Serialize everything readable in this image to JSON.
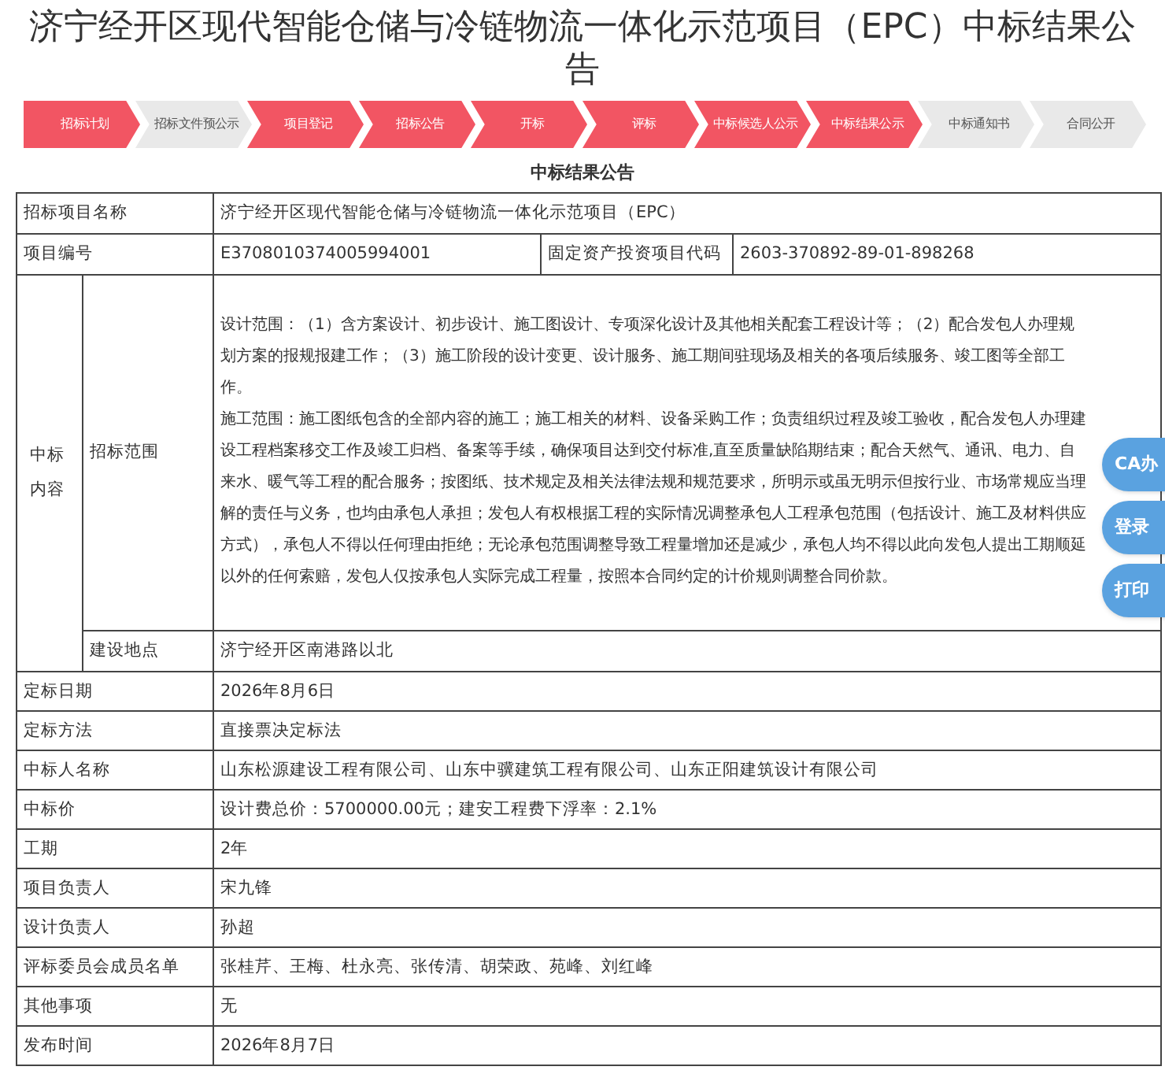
{
  "title": "济宁经开区现代智能仓储与冷链物流一体化示范项目（EPC）中标结果公告",
  "steps": [
    {
      "label": "招标计划",
      "done": true
    },
    {
      "label": "招标文件预公示",
      "done": false
    },
    {
      "label": "项目登记",
      "done": true
    },
    {
      "label": "招标公告",
      "done": true
    },
    {
      "label": "开标",
      "done": true
    },
    {
      "label": "评标",
      "done": true
    },
    {
      "label": "中标候选人公示",
      "done": true
    },
    {
      "label": "中标结果公示",
      "done": true
    },
    {
      "label": "中标通知书",
      "done": false
    },
    {
      "label": "合同公开",
      "done": false
    }
  ],
  "table": {
    "caption": "中标结果公告",
    "project_name": {
      "label": "招标项目名称",
      "value": "济宁经开区现代智能仓储与冷链物流一体化示范项目（EPC）"
    },
    "project_code": {
      "label": "项目编号",
      "value": "E3708010374005994001",
      "label_2": "固定资产投资项目代码",
      "value_2": "2603-370892-89-01-898268"
    },
    "content": {
      "label": "中标内容",
      "scope_label": "招标范围",
      "scope": [
        "设计范围：（1）含方案设计、初步设计、施工图设计、专项深化设计及其他相关配套工程设计等；（2）配合发包人办理规划方案的报规报建工作；（3）施工阶段的设计变更、设计服务、施工期间驻现场及相关的各项后续服务、竣工图等全部工作。",
        "施工范围：施工图纸包含的全部内容的施工；施工相关的材料、设备采购工作；负责组织过程及竣工验收，配合发包人办理建设工程档案移交工作及竣工归档、备案等手续，确保项目达到交付标准,直至质量缺陷期结束；配合天然气、通讯、电力、自来水、暖气等工程的配合服务；按图纸、技术规定及相关法律法规和规范要求，所明示或虽无明示但按行业、市场常规应当理解的责任与义务，也均由承包人承担；发包人有权根据工程的实际情况调整承包人工程承包范围（包括设计、施工及材料供应方式），承包人不得以任何理由拒绝；无论承包范围调整导致工程量增加还是减少，承包人均不得以此向发包人提出工期顺延以外的任何索赔，发包人仅按承包人实际完成工程量，按照本合同约定的计价规则调整合同价款。"
      ],
      "site_label": "建设地点",
      "site": "济宁经开区南港路以北"
    },
    "rows": [
      {
        "label": "定标日期",
        "value": "2026年8月6日"
      },
      {
        "label": "定标方法",
        "value": "直接票决定标法"
      },
      {
        "label": "中标人名称",
        "value": "山东松源建设工程有限公司、山东中骥建筑工程有限公司、山东正阳建筑设计有限公司"
      },
      {
        "label": "中标价",
        "value": "设计费总价：5700000.00元；建安工程费下浮率：2.1%"
      },
      {
        "label": "工期",
        "value": "2年"
      },
      {
        "label": "项目负责人",
        "value": "宋九锋"
      },
      {
        "label": "设计负责人",
        "value": "孙超"
      },
      {
        "label": "评标委员会成员名单",
        "value": "张桂芹、王梅、杜永亮、张传清、胡荣政、苑峰、刘红峰"
      },
      {
        "label": "其他事项",
        "value": "无"
      },
      {
        "label": "发布时间",
        "value": "2026年8月7日"
      }
    ]
  },
  "side_buttons": [
    "CA办",
    "登录",
    "打印"
  ]
}
